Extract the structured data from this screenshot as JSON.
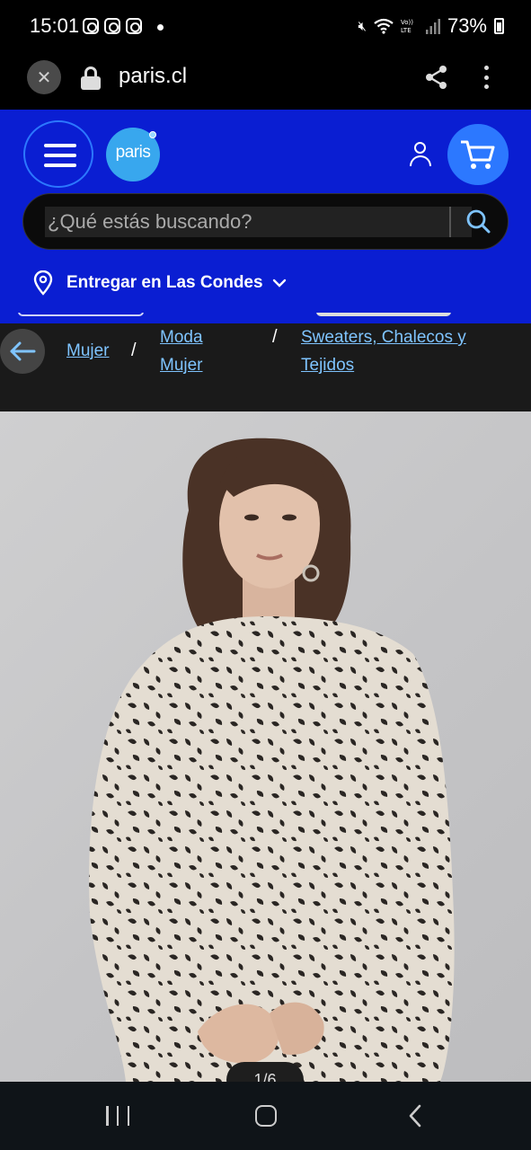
{
  "status_bar": {
    "time": "15:01",
    "apps": [
      "instagram-icon",
      "instagram-icon",
      "instagram-icon"
    ],
    "system_icons": [
      "mute-icon",
      "wifi-icon",
      "volte-icon",
      "signal-icon"
    ],
    "battery": "73%"
  },
  "browser": {
    "url": "paris.cl",
    "close_icon": "✕"
  },
  "header": {
    "logo_text": "paris",
    "search": {
      "placeholder": "¿Qué estás buscando?"
    },
    "delivery": "Entregar en Las Condes",
    "colors": {
      "brand_blue": "#0a1ed2",
      "accent_blue": "#2c78ff",
      "link_blue": "#7fc4ff"
    }
  },
  "breadcrumb": {
    "items": [
      "Mujer",
      "Moda Mujer",
      "Sweaters, Chalecos y Tejidos"
    ],
    "lines": {
      "moda_1": "Moda",
      "moda_2": "Mujer",
      "sweaters_1": "Sweaters, Chalecos y",
      "sweaters_2": "Tejidos"
    },
    "separator": "/"
  },
  "product": {
    "image_alt": "Mujer con sweater de estampado leopardo",
    "image_counter": "1/6"
  }
}
